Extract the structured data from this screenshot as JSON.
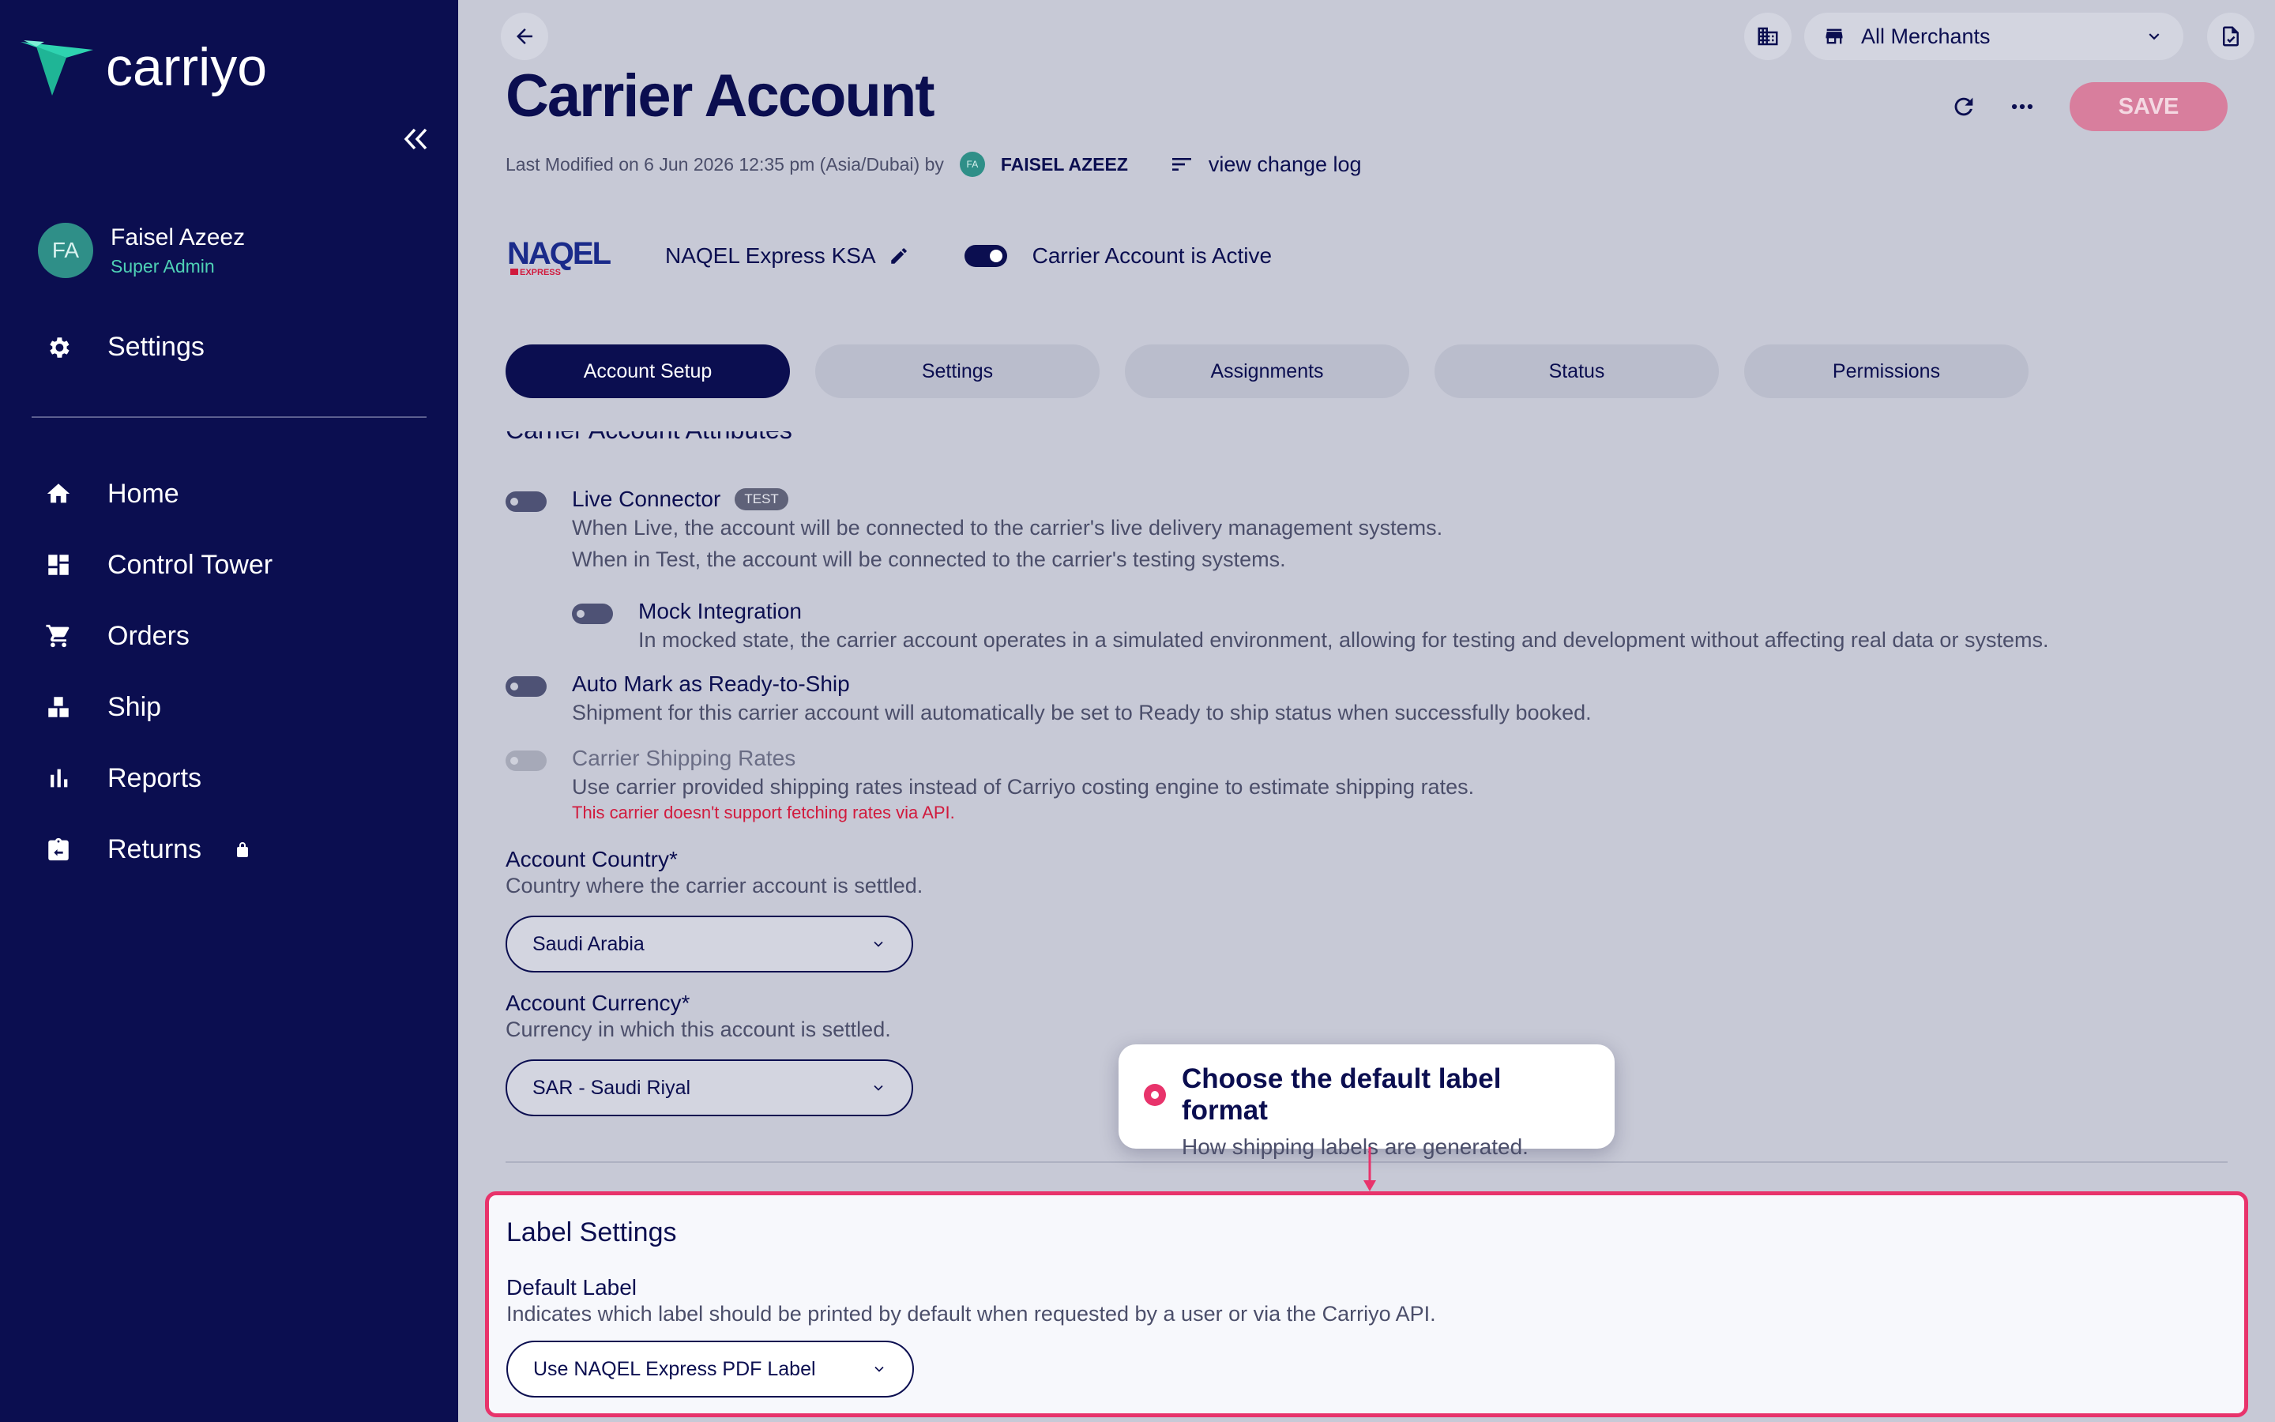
{
  "sidebar": {
    "brand": "carriyo",
    "user": {
      "initials": "FA",
      "name": "Faisel Azeez",
      "role": "Super Admin"
    },
    "settings_label": "Settings",
    "items": [
      {
        "label": "Home",
        "icon": "home-icon"
      },
      {
        "label": "Control Tower",
        "icon": "dashboard-icon"
      },
      {
        "label": "Orders",
        "icon": "cart-icon"
      },
      {
        "label": "Ship",
        "icon": "ship-icon"
      },
      {
        "label": "Reports",
        "icon": "reports-icon"
      },
      {
        "label": "Returns",
        "icon": "returns-icon",
        "locked": true
      }
    ]
  },
  "header": {
    "title": "Carrier Account",
    "meta_prefix": "Last Modified on 6 Jun 2026 12:35 pm (Asia/Dubai) by",
    "meta_initials": "FA",
    "meta_user": "FAISEL AZEEZ",
    "change_log": "view change log",
    "merchant_select": "All Merchants",
    "save_label": "SAVE"
  },
  "carrier": {
    "logo_text": "NAQEL",
    "logo_sub": "EXPRESS",
    "name": "NAQEL Express KSA",
    "active_label": "Carrier Account is Active"
  },
  "tabs": [
    {
      "label": "Account Setup",
      "active": true
    },
    {
      "label": "Settings",
      "active": false
    },
    {
      "label": "Assignments",
      "active": false
    },
    {
      "label": "Status",
      "active": false
    },
    {
      "label": "Permissions",
      "active": false
    }
  ],
  "attributes": {
    "title": "Carrier Account Attributes",
    "live": {
      "title": "Live Connector",
      "badge": "TEST",
      "desc1": "When Live, the account will be connected to the carrier's live delivery management systems.",
      "desc2": "When in Test, the account will be connected to the carrier's testing systems."
    },
    "mock": {
      "title": "Mock Integration",
      "desc": "In mocked state, the carrier account operates in a simulated environment, allowing for testing and development without affecting real data or systems."
    },
    "auto": {
      "title": "Auto Mark as Ready-to-Ship",
      "desc": "Shipment for this carrier account will automatically be set to Ready to ship status when successfully booked."
    },
    "rates": {
      "title": "Carrier Shipping Rates",
      "desc": "Use carrier provided shipping rates instead of Carriyo costing engine to estimate shipping rates.",
      "warning": "This carrier doesn't support fetching rates via API."
    }
  },
  "country": {
    "label": "Account Country*",
    "desc": "Country where the carrier account is settled.",
    "value": "Saudi Arabia"
  },
  "currency": {
    "label": "Account Currency*",
    "desc": "Currency in which this account is settled.",
    "value": "SAR - Saudi Riyal"
  },
  "callout": {
    "title": "Choose the default label format",
    "subtitle": "How shipping labels are generated."
  },
  "label_settings": {
    "title": "Label Settings",
    "field_label": "Default Label",
    "field_desc": "Indicates which label should be printed by default when requested by a user or via the Carriyo API.",
    "value": "Use NAQEL Express PDF Label"
  },
  "colors": {
    "sidebar_bg": "#0b0e50",
    "accent": "#e8336b",
    "teal": "#4fd1b5"
  }
}
